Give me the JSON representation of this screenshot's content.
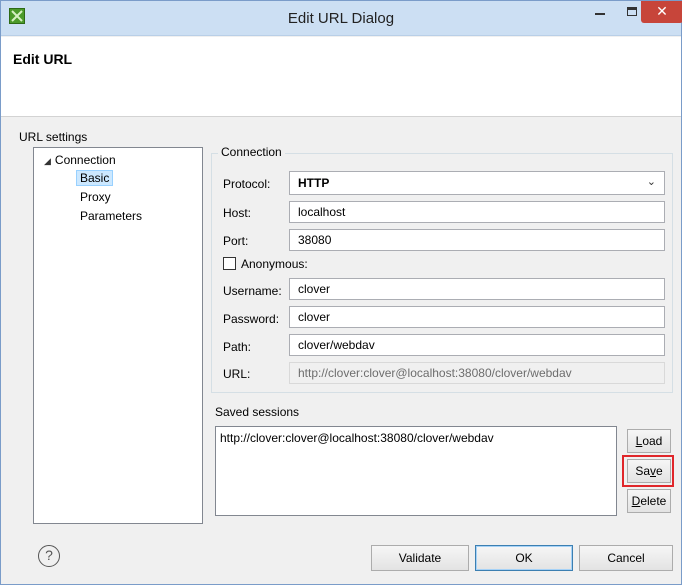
{
  "window": {
    "title": "Edit URL Dialog",
    "close_glyph": "✕"
  },
  "header": {
    "title": "Edit URL"
  },
  "section_label": "URL settings",
  "tree": {
    "root": "Connection",
    "items": [
      "Basic",
      "Proxy",
      "Parameters"
    ],
    "selected": "Basic"
  },
  "connection": {
    "legend": "Connection",
    "protocol": {
      "label": "Protocol:",
      "value": "HTTP"
    },
    "host": {
      "label": "Host:",
      "value": "localhost"
    },
    "port": {
      "label": "Port:",
      "value": "38080"
    },
    "anonymous": {
      "label": "Anonymous:",
      "checked": false
    },
    "username": {
      "label": "Username:",
      "value": "clover"
    },
    "password": {
      "label": "Password:",
      "value": "clover"
    },
    "path": {
      "label": "Path:",
      "value": "clover/webdav"
    },
    "url": {
      "label": "URL:",
      "value": "http://clover:clover@localhost:38080/clover/webdav"
    }
  },
  "saved_sessions": {
    "label": "Saved sessions",
    "items": [
      "http://clover:clover@localhost:38080/clover/webdav"
    ],
    "buttons": {
      "load": {
        "mnemonic": "L",
        "rest": "oad"
      },
      "save": {
        "pre": "Sa",
        "mnemonic": "v",
        "rest": "e"
      },
      "delete": {
        "mnemonic": "D",
        "rest": "elete"
      }
    }
  },
  "footer": {
    "help": "?",
    "validate": "Validate",
    "ok": "OK",
    "cancel": "Cancel"
  },
  "colors": {
    "titlebar": "#ccdff3",
    "close": "#c7453a",
    "highlight": "#e0262a",
    "selection": "#cce8ff"
  },
  "icons": {
    "app": "app-icon",
    "help": "help-icon",
    "dropdown": "chevron-down-icon",
    "tree_expand": "triangle-down-icon"
  }
}
